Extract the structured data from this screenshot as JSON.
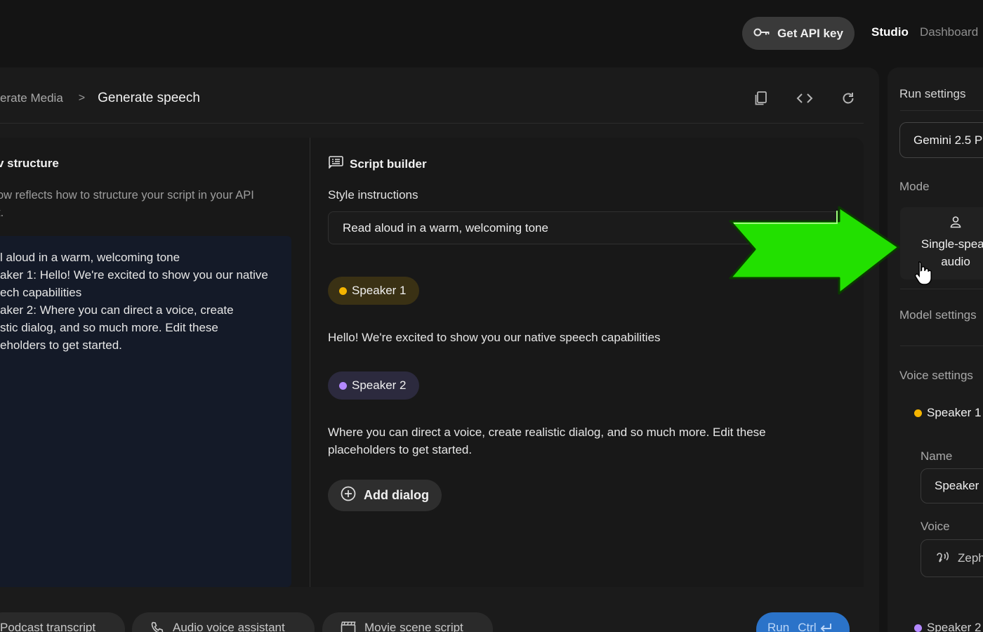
{
  "topbar": {
    "api_key_label": "Get API key",
    "studio_label": "Studio",
    "dashboard_label": "Dashboard"
  },
  "breadcrumb": {
    "parent": "erate Media",
    "separator": ">",
    "current": "Generate speech"
  },
  "left_panel": {
    "title": "v structure",
    "description_lines": [
      "ow reflects how to structure your script in your API",
      "t."
    ],
    "code_lines": [
      "l aloud in a warm, welcoming tone",
      "aker 1: Hello! We're excited to show you our native",
      "ech capabilities",
      "aker 2: Where you can direct a voice, create",
      "stic dialog, and so much more. Edit these",
      "eholders to get started."
    ]
  },
  "script_builder": {
    "title": "Script builder",
    "style_label": "Style instructions",
    "style_value": "Read aloud in a warm, welcoming tone",
    "speaker1_label": "Speaker 1",
    "speaker1_text": "Hello! We're excited to show you our native speech capabilities",
    "speaker2_label": "Speaker 2",
    "speaker2_text": "Where you can direct a voice, create realistic dialog, and so much more. Edit these placeholders to get started.",
    "add_dialog_label": "Add dialog"
  },
  "bottom_bar": {
    "chip1": "Podcast transcript",
    "chip2": "Audio voice assistant",
    "chip3": "Movie scene script",
    "run_label": "Run",
    "run_shortcut": "Ctrl"
  },
  "run_settings": {
    "title": "Run settings",
    "model": "Gemini 2.5 P",
    "mode_label": "Mode",
    "mode_value": "Single-speak\naudio",
    "mode_line1": "Single-speak",
    "mode_line2": "audio",
    "model_settings_label": "Model settings",
    "voice_settings_label": "Voice settings",
    "speaker1_label": "Speaker 1",
    "name_label": "Name",
    "name_value": "Speaker",
    "voice_label": "Voice",
    "voice_value": "Zeph",
    "speaker2_label": "Speaker 2"
  },
  "colors": {
    "speaker1_dot": "#f4b400",
    "speaker2_dot": "#b388ff",
    "arrow": "#22e000",
    "run_button": "#2b73c9"
  },
  "icons": [
    "key-icon",
    "copy-icon",
    "code-icon",
    "refresh-icon",
    "script-icon",
    "add-circle-icon",
    "phone-icon",
    "clapperboard-icon",
    "person-icon",
    "voice-icon",
    "hand-cursor-icon",
    "arrow-annotation-icon"
  ]
}
